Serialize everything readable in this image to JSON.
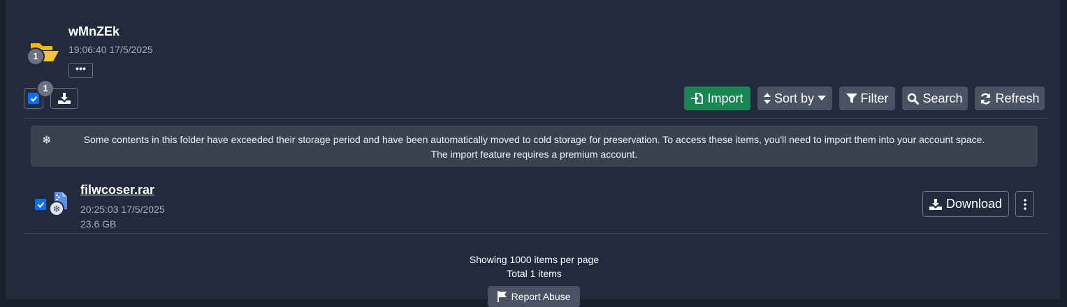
{
  "folder": {
    "name": "wMnZEk",
    "date": "19:06:40 17/5/2025",
    "badge_count": "1",
    "more_label": "•••",
    "icon": "folder-icon"
  },
  "selection": {
    "selected_count": "1",
    "checked": true
  },
  "toolbar": {
    "import_label": "Import",
    "sort_label": "Sort by",
    "filter_label": "Filter",
    "search_label": "Search",
    "refresh_label": "Refresh"
  },
  "notice": {
    "line1": "Some contents in this folder have exceeded their storage period and have been automatically moved to cold storage for preservation. To access these items, you'll need to import them into your account space.",
    "line2": "The import feature requires a premium account.",
    "icon": "snowflake-icon"
  },
  "files": [
    {
      "name": "filwcoser.rar",
      "date": "20:25:03 17/5/2025",
      "size": "23.6 GB",
      "checked": true,
      "download_label": "Download",
      "icon": "frozen-file-icon"
    }
  ],
  "footer": {
    "per_page": "Showing 1000 items per page",
    "total": "Total 1 items",
    "report_label": "Report Abuse"
  },
  "colors": {
    "background": "#222a3b",
    "accent_green": "#198754",
    "checkbox_blue": "#0d6efd",
    "folder_yellow": "#f5b90b",
    "button_gray": "#4b5263"
  }
}
